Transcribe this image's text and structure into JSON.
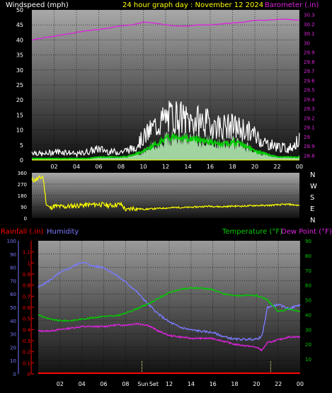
{
  "header": {
    "wind_label": "Windspeed (mph)",
    "title": "24 hour graph day : November 12 2024",
    "baro_label": "Barometer (.in)"
  },
  "mid_header": {
    "rain_label": "Rainfall (.in)",
    "humidity_label": "Humidity",
    "temp_label": "Temperature (°F)",
    "dew_label": "Dew Point (°F)"
  },
  "colors": {
    "wind_white": "#ffffff",
    "wind_gust": "#ffffff",
    "wind_avg": "#00cc00",
    "wind_fill": "#b9f5b9",
    "baro": "#dd22dd",
    "title": "#ffff00",
    "winddir": "#ffff00",
    "rain": "#ff0000",
    "humidity": "#7a7aff",
    "temp": "#00cc00",
    "dew": "#dd22dd",
    "sun": "#ffff80"
  },
  "chart_data": [
    {
      "type": "line",
      "panel": "wind-barometer",
      "x_ticks": [
        "02",
        "04",
        "06",
        "08",
        "10",
        "12",
        "14",
        "16",
        "18",
        "20",
        "22",
        "00"
      ],
      "xlim": [
        0,
        24
      ],
      "ylabel": "Windspeed (mph)",
      "ylim": [
        0,
        50
      ],
      "y_ticks": [
        "0",
        "5",
        "10",
        "15",
        "20",
        "25",
        "30",
        "35",
        "40",
        "45",
        "50"
      ],
      "y2label": "Barometer (.in)",
      "y2lim": [
        28.75,
        30.35
      ],
      "y2_ticks": [
        "28.8",
        "28.9",
        "29",
        "29.1",
        "29.2",
        "29.3",
        "29.4",
        "29.5",
        "29.6",
        "29.7",
        "29.8",
        "29.9",
        "30",
        "30.1",
        "30.2",
        "30.3"
      ],
      "series": [
        {
          "name": "Wind Gust",
          "x": [
            0,
            1,
            2,
            3,
            4,
            5,
            6,
            7,
            8,
            9,
            10,
            11,
            12,
            13,
            14,
            15,
            16,
            17,
            18,
            19,
            20,
            21,
            22,
            23,
            24
          ],
          "values": [
            3,
            2,
            3,
            3,
            2,
            3,
            4,
            3,
            3,
            4,
            8,
            12,
            15,
            16,
            14,
            14,
            13,
            12,
            12,
            11,
            9,
            6,
            5,
            4,
            7
          ]
        },
        {
          "name": "Wind Average",
          "x": [
            0,
            1,
            2,
            3,
            4,
            5,
            6,
            7,
            8,
            9,
            10,
            11,
            12,
            13,
            14,
            15,
            16,
            17,
            18,
            19,
            20,
            21,
            22,
            23,
            24
          ],
          "values": [
            0.5,
            0.5,
            0.5,
            0.5,
            0.5,
            0.5,
            1,
            1,
            1,
            1.5,
            3,
            5,
            7,
            8,
            7,
            7,
            6,
            5,
            6,
            5,
            3,
            2,
            1,
            1,
            1
          ]
        },
        {
          "name": "Barometer",
          "x": [
            0,
            1,
            2,
            3,
            4,
            5,
            6,
            7,
            8,
            9,
            10,
            11,
            12,
            13,
            14,
            15,
            16,
            17,
            18,
            19,
            20,
            21,
            22,
            23,
            24
          ],
          "values": [
            30.03,
            30.05,
            30.07,
            30.09,
            30.11,
            30.13,
            30.14,
            30.16,
            30.18,
            30.19,
            30.22,
            30.21,
            30.19,
            30.18,
            30.18,
            30.19,
            30.19,
            30.2,
            30.21,
            30.22,
            30.24,
            30.24,
            30.25,
            30.25,
            30.24
          ]
        }
      ]
    },
    {
      "type": "line",
      "panel": "wind-direction",
      "x_ticks": [],
      "xlim": [
        0,
        24
      ],
      "ylim": [
        0,
        360
      ],
      "y_ticks": [
        "0",
        "90",
        "180",
        "270",
        "360"
      ],
      "y2_ticks": [
        "N",
        "W",
        "S",
        "E",
        "N"
      ],
      "series": [
        {
          "name": "Wind Direction",
          "x": [
            0,
            0.5,
            1,
            1.3,
            1.6,
            2,
            3,
            4,
            5,
            6,
            7,
            8,
            8.5,
            9,
            9.5,
            10,
            11,
            12,
            13,
            14,
            15,
            16,
            17,
            18,
            19,
            20,
            21,
            22,
            23,
            24
          ],
          "values": [
            300,
            310,
            330,
            110,
            80,
            95,
            90,
            100,
            105,
            110,
            100,
            110,
            60,
            80,
            75,
            70,
            75,
            80,
            85,
            85,
            90,
            95,
            90,
            95,
            95,
            100,
            100,
            105,
            110,
            100
          ]
        }
      ]
    },
    {
      "type": "line",
      "panel": "temperature-humidity-rain",
      "x_ticks": [
        "02",
        "04",
        "06",
        "08",
        "Sun",
        "Set",
        "12",
        "14",
        "16",
        "18",
        "20",
        "22",
        "00"
      ],
      "xlim": [
        0,
        24
      ],
      "ylabel": "Rainfall (.in)",
      "rain_ylim": [
        0,
        1.2
      ],
      "rain_ticks": [
        "0",
        "0.1",
        "0.2",
        "0.3",
        "0.4",
        "0.5",
        "0.6",
        "0.7",
        "0.8",
        "0.9",
        "1",
        "1.1"
      ],
      "humidity_ylim": [
        0,
        100
      ],
      "humidity_ticks": [
        "0",
        "10",
        "20",
        "30",
        "40",
        "50",
        "60",
        "70",
        "80",
        "90",
        "100"
      ],
      "temp_ylim": [
        0,
        90
      ],
      "temp_ticks": [
        "10",
        "20",
        "30",
        "40",
        "50",
        "60",
        "70",
        "80",
        "90"
      ],
      "series": [
        {
          "name": "Humidity",
          "x": [
            0,
            1,
            2,
            3,
            4,
            5,
            6,
            7,
            8,
            9,
            10,
            11,
            12,
            13,
            14,
            15,
            16,
            17,
            18,
            19,
            20,
            20.5,
            21,
            22,
            23,
            24
          ],
          "values": [
            65,
            70,
            76,
            80,
            84,
            81,
            80,
            75,
            69,
            62,
            53,
            45,
            39,
            35,
            33,
            32,
            31,
            28,
            26,
            26,
            26,
            28,
            50,
            52,
            49,
            52
          ]
        },
        {
          "name": "Temperature",
          "x": [
            0,
            1,
            2,
            3,
            4,
            5,
            6,
            7,
            8,
            9,
            10,
            11,
            12,
            13,
            14,
            15,
            16,
            17,
            18,
            19,
            20,
            21,
            22,
            23,
            24
          ],
          "values": [
            40,
            37,
            36,
            36,
            37,
            38,
            39,
            39,
            41,
            44,
            47,
            51,
            55,
            57,
            58,
            58,
            57,
            54,
            53,
            53,
            53,
            50,
            42,
            44,
            42
          ]
        },
        {
          "name": "Dew Point",
          "x": [
            0,
            1,
            2,
            3,
            4,
            5,
            6,
            7,
            8,
            9,
            10,
            11,
            12,
            13,
            14,
            15,
            16,
            17,
            18,
            19,
            20,
            20.5,
            21,
            22,
            23,
            24
          ],
          "values": [
            29,
            29,
            30,
            31,
            32,
            32,
            32,
            33,
            33,
            34,
            33,
            29,
            26,
            25,
            24,
            24,
            24,
            22,
            20,
            19,
            18,
            16,
            21,
            23,
            25,
            25
          ]
        },
        {
          "name": "Rainfall",
          "x": [
            0,
            24
          ],
          "values": [
            0,
            0
          ]
        }
      ],
      "sunrise_hour": 9.5,
      "sunset_hour": 21.3
    }
  ]
}
